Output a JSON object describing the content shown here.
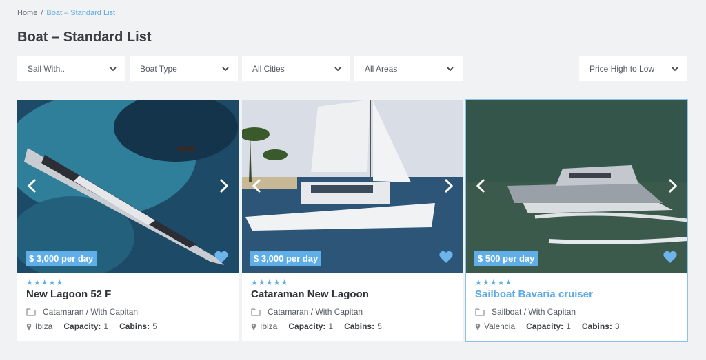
{
  "breadcrumb": {
    "home": "Home",
    "separator": "/",
    "current": "Boat – Standard List"
  },
  "page_title": "Boat – Standard List",
  "filters": [
    {
      "label": "Sail With..",
      "icon": "chevron-down-icon"
    },
    {
      "label": "Boat Type",
      "icon": "chevron-down-icon"
    },
    {
      "label": "All Cities",
      "icon": "chevron-down-icon"
    },
    {
      "label": "All Areas",
      "icon": "chevron-down-icon"
    }
  ],
  "sort": {
    "label": "Price High to Low",
    "icon": "chevron-down-icon"
  },
  "cards": [
    {
      "price": "$ 3,000 per day",
      "stars": 5,
      "name": "New Lagoon 52 F",
      "type": "Catamaran / With Capitan",
      "location": "Ibiza",
      "capacity_label": "Capacity:",
      "capacity": "1",
      "cabins_label": "Cabins:",
      "cabins": "5"
    },
    {
      "price": "$ 3,000 per day",
      "stars": 5,
      "name": "Cataraman New Lagoon",
      "type": "Catamaran / With Capitan",
      "location": "Ibiza",
      "capacity_label": "Capacity:",
      "capacity": "1",
      "cabins_label": "Cabins:",
      "cabins": "5"
    },
    {
      "price": "$ 500 per day",
      "stars": 5,
      "name": "Sailboat Bavaria cruiser",
      "type": "Sailboat / With Capitan",
      "location": "Valencia",
      "capacity_label": "Capacity:",
      "capacity": "1",
      "cabins_label": "Cabins:",
      "cabins": "3"
    }
  ],
  "colors": {
    "accent": "#60aee8",
    "background": "#f1f2f4",
    "title": "#3a3d42"
  }
}
